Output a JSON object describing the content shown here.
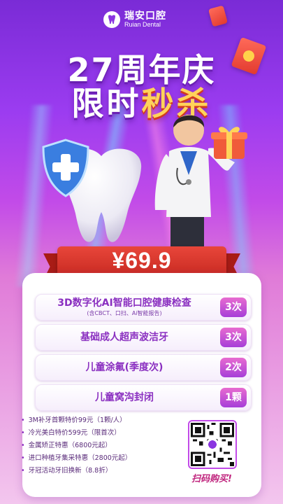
{
  "brand": {
    "name_cn": "瑞安口腔",
    "name_en": "Ruian Dental"
  },
  "headline": {
    "line1": "27周年庆",
    "line2_a": "限时",
    "line2_b": "秒杀"
  },
  "price": "¥69.9",
  "items": [
    {
      "name": "3D数字化AI智能口腔健康检查",
      "sub": "(含CBCT、口扫、Ai智能报告)",
      "badge": "3次"
    },
    {
      "name": "基础成人超声波洁牙",
      "badge": "3次"
    },
    {
      "name": "儿童涂氟(季度次)",
      "badge": "2次"
    },
    {
      "name": "儿童窝沟封闭",
      "badge": "1颗"
    }
  ],
  "perks": [
    "3M补牙首颗特价99元（1颗/人）",
    "冷光美白特价599元（限首次）",
    "金属矫正特惠（6800元起）",
    "进口种植牙集采特惠（2800元起）",
    "牙冠活动牙旧换新（8.8折）"
  ],
  "qr_caption": "扫码购买!",
  "colors": {
    "accent": "#8a2fc0",
    "ribbon": "#d8352b",
    "price_highlight": "#ffd35a"
  },
  "icons": [
    "tooth-logo-icon",
    "shield-cross-icon",
    "tooth-icon",
    "doctor-illustration",
    "gift-box-icon",
    "red-packet-icon",
    "qr-code"
  ]
}
